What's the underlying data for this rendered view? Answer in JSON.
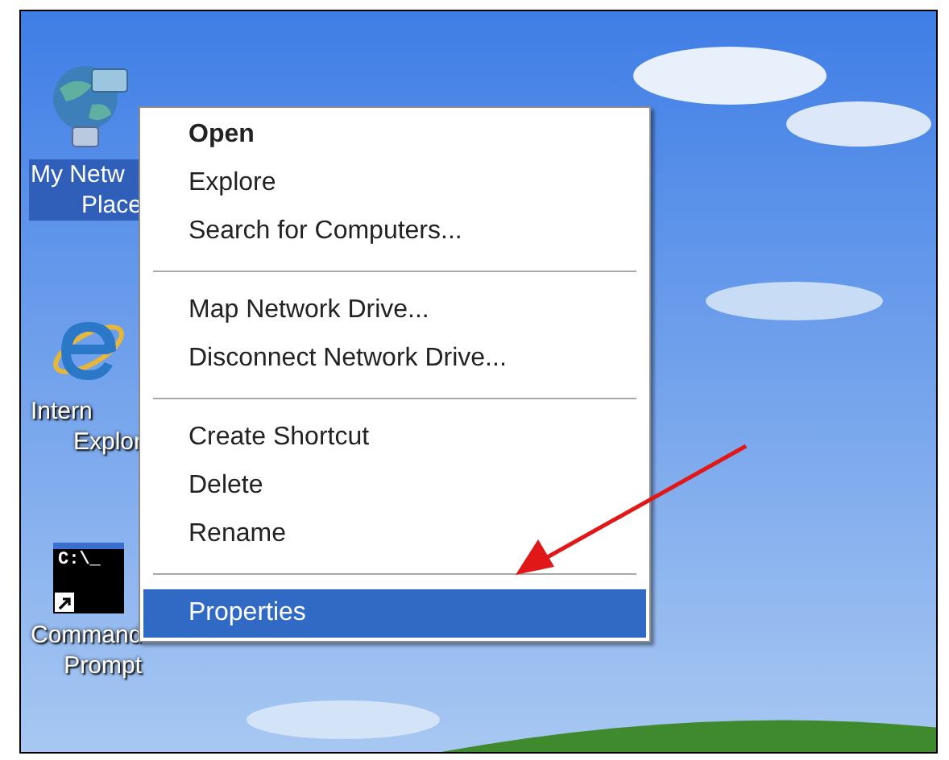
{
  "desktop_icons": [
    {
      "kind": "network",
      "label_lines": [
        "My Netw",
        "Place"
      ],
      "selected": true
    },
    {
      "kind": "browser",
      "label_lines": [
        "Intern",
        "Explor"
      ],
      "selected": false
    },
    {
      "kind": "console",
      "label_lines": [
        "Command",
        "Prompt"
      ],
      "selected": false,
      "icon_text": "C:\\_"
    }
  ],
  "context_menu": {
    "groups": [
      [
        {
          "label": "Open",
          "bold": true,
          "selected": false
        },
        {
          "label": "Explore",
          "bold": false,
          "selected": false
        },
        {
          "label": "Search for Computers...",
          "bold": false,
          "selected": false
        }
      ],
      [
        {
          "label": "Map Network Drive...",
          "bold": false,
          "selected": false
        },
        {
          "label": "Disconnect Network Drive...",
          "bold": false,
          "selected": false
        }
      ],
      [
        {
          "label": "Create Shortcut",
          "bold": false,
          "selected": false
        },
        {
          "label": "Delete",
          "bold": false,
          "selected": false
        },
        {
          "label": "Rename",
          "bold": false,
          "selected": false
        }
      ],
      [
        {
          "label": "Properties",
          "bold": false,
          "selected": true
        }
      ]
    ]
  }
}
